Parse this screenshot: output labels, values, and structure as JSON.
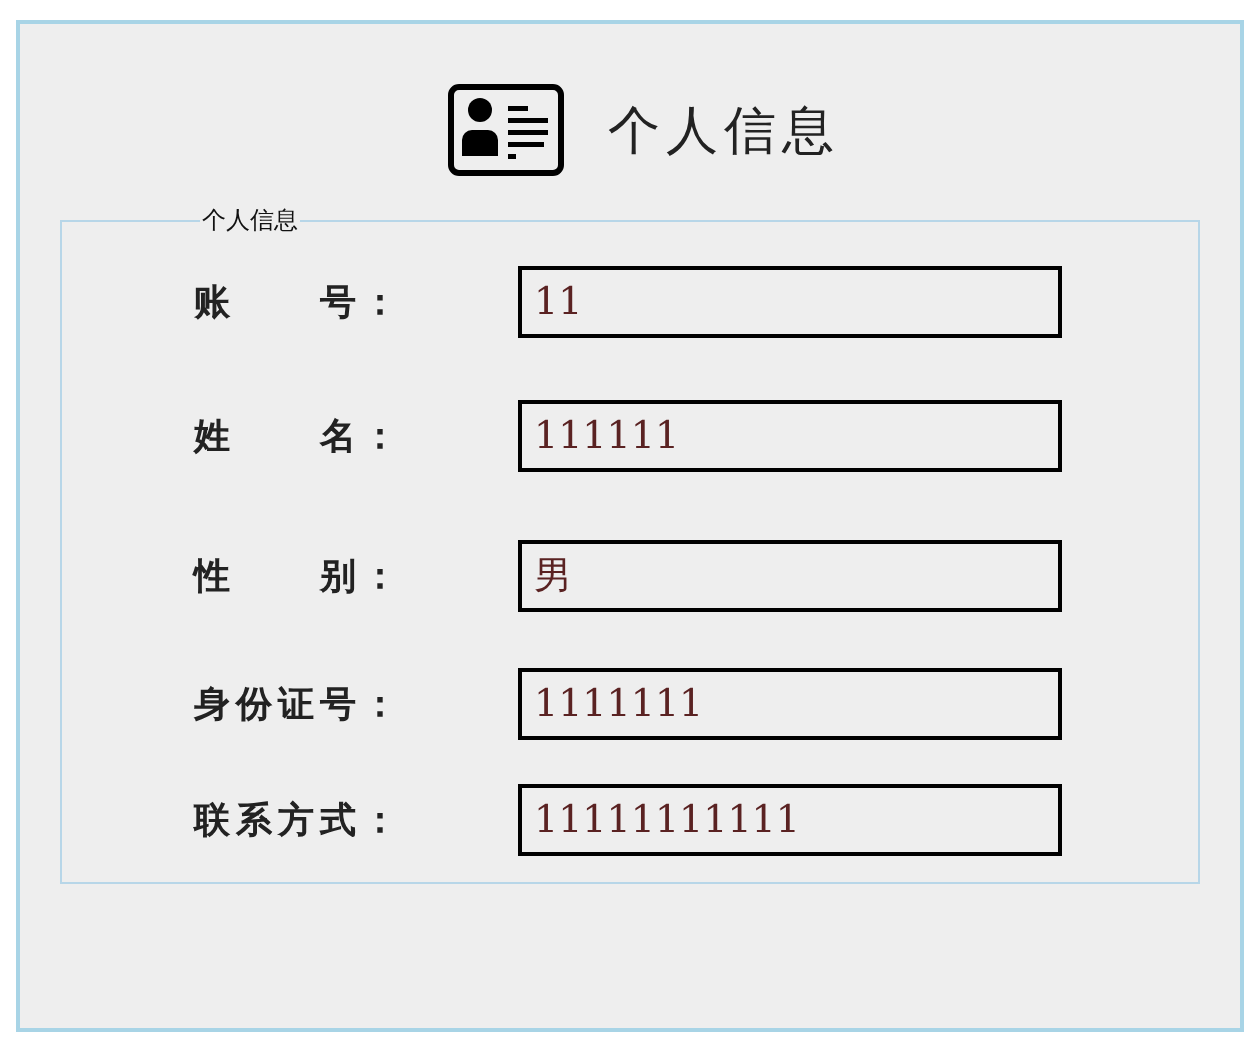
{
  "window": {
    "title": "个人信息"
  },
  "group": {
    "legend": "个人信息",
    "fields": [
      {
        "label": "账　　号：",
        "value": "11"
      },
      {
        "label": "姓　　名：",
        "value": "111111"
      },
      {
        "label": "性　　别：",
        "value": "男"
      },
      {
        "label": "身份证号：",
        "value": "1111111"
      },
      {
        "label": "联系方式：",
        "value": "11111111111"
      }
    ]
  }
}
